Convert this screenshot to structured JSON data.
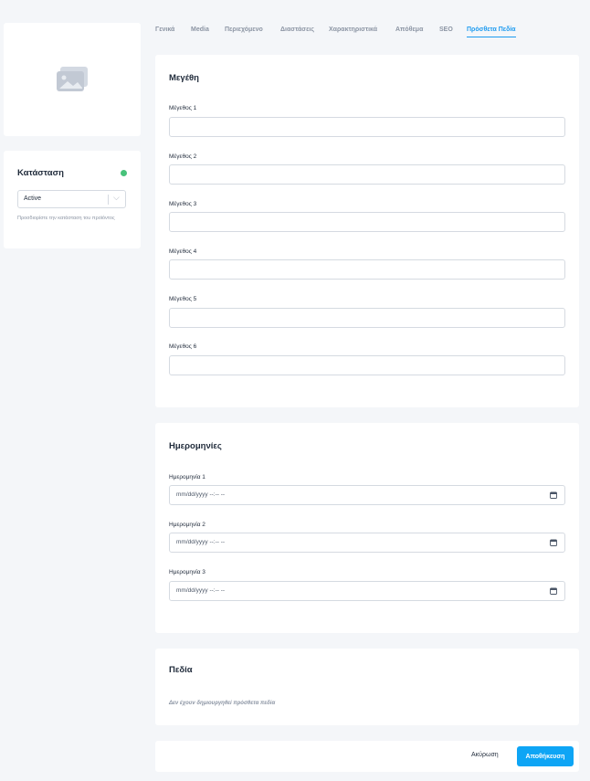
{
  "tabs": [
    {
      "label": "Γενικά"
    },
    {
      "label": "Media"
    },
    {
      "label": "Περιεχόμενο"
    },
    {
      "label": "Διαστάσεις"
    },
    {
      "label": "Χαρακτηριστικά"
    },
    {
      "label": "Απόθεμα"
    },
    {
      "label": "SEO"
    },
    {
      "label": "Πρόσθετα Πεδία",
      "active": true
    }
  ],
  "image_placeholder": {
    "icon": "image-placeholder-icon"
  },
  "status": {
    "title": "Κατάσταση",
    "indicator_color": "#47c27a",
    "selected": "Active",
    "help": "Προσδιορίστε την κατάσταση του προϊόντος"
  },
  "sizes": {
    "title": "Μεγέθη",
    "fields": [
      {
        "label": "Μέγεθος 1",
        "value": ""
      },
      {
        "label": "Μέγεθος 2",
        "value": ""
      },
      {
        "label": "Μέγεθος 3",
        "value": ""
      },
      {
        "label": "Μέγεθος 4",
        "value": ""
      },
      {
        "label": "Μέγεθος 5",
        "value": ""
      },
      {
        "label": "Μέγεθος 6",
        "value": ""
      }
    ]
  },
  "dates": {
    "title": "Ημερομηνίες",
    "fields": [
      {
        "label": "Ημερομηνία 1",
        "placeholder": "mm/dd/yyyy --:-- --"
      },
      {
        "label": "Ημερομηνία 2",
        "placeholder": "mm/dd/yyyy --:-- --"
      },
      {
        "label": "Ημερομηνία 3",
        "placeholder": "mm/dd/yyyy --:-- --"
      }
    ]
  },
  "fields_section": {
    "title": "Πεδία",
    "empty_note": "Δεν έχουν δημιουργηθεί πρόσθετα πεδία"
  },
  "actions": {
    "cancel": "Ακύρωση",
    "save": "Αποθήκευση",
    "accent_color": "#0ea5f5"
  }
}
